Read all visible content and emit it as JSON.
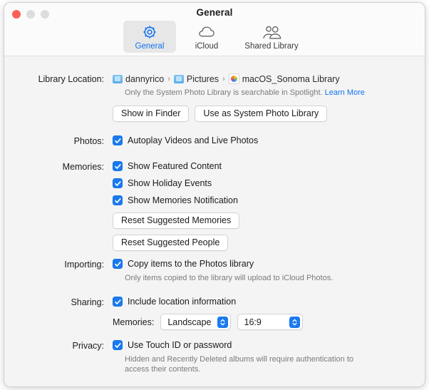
{
  "window": {
    "title": "General",
    "traffic_lights": [
      "close-button",
      "minimize-button",
      "zoom-button"
    ]
  },
  "toolbar": {
    "tabs": [
      {
        "label": "General",
        "icon": "gear-icon",
        "selected": true
      },
      {
        "label": "iCloud",
        "icon": "cloud-icon",
        "selected": false
      },
      {
        "label": "Shared Library",
        "icon": "people-icon",
        "selected": false
      }
    ]
  },
  "library_location": {
    "label": "Library Location:",
    "breadcrumb": [
      {
        "name": "dannyrico",
        "icon": "folder-icon"
      },
      {
        "name": "Pictures",
        "icon": "folder-icon"
      },
      {
        "name": "macOS_Sonoma Library",
        "icon": "photos-library-icon"
      }
    ],
    "separator": "›",
    "note": "Only the System Photo Library is searchable in Spotlight.",
    "learn_more": "Learn More",
    "buttons": [
      "Show in Finder",
      "Use as System Photo Library"
    ]
  },
  "photos": {
    "label": "Photos:",
    "autoplay": {
      "text": "Autoplay Videos and Live Photos",
      "checked": true
    }
  },
  "memories": {
    "label": "Memories:",
    "featured": {
      "text": "Show Featured Content",
      "checked": true
    },
    "holiday": {
      "text": "Show Holiday Events",
      "checked": true
    },
    "notification": {
      "text": "Show Memories Notification",
      "checked": true
    },
    "reset_memories_button": "Reset Suggested Memories",
    "reset_people_button": "Reset Suggested People"
  },
  "importing": {
    "label": "Importing:",
    "copy_items": {
      "text": "Copy items to the Photos library",
      "checked": true
    },
    "note": "Only items copied to the library will upload to iCloud Photos."
  },
  "sharing": {
    "label": "Sharing:",
    "include_location": {
      "text": "Include location information",
      "checked": true
    },
    "memories_label": "Memories:",
    "orientation_value": "Landscape",
    "aspect_value": "16:9"
  },
  "privacy": {
    "label": "Privacy:",
    "touch_id": {
      "text": "Use Touch ID or password",
      "checked": true
    },
    "note_line1": "Hidden and Recently Deleted albums will require authentication to",
    "note_line2": "access their contents."
  },
  "colors": {
    "accent": "#1a7af0",
    "link": "#1273ed",
    "window_bg": "#f4f4f4",
    "titlebar_bg": "#fbfbfb",
    "close_red": "#fc6058"
  }
}
